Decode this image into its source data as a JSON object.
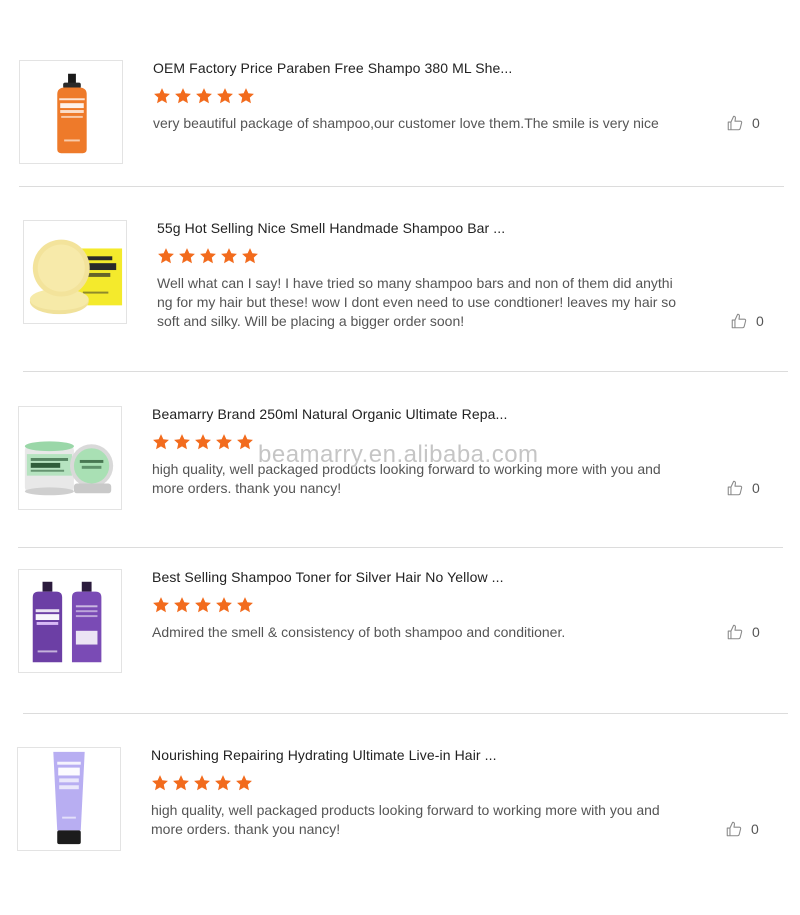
{
  "watermark": "beamarry.en.alibaba.com",
  "colors": {
    "star": "#f26b1d",
    "divider": "#dcdcdc"
  },
  "reviews": [
    {
      "title": "OEM Factory Price Paraben Free Shampo 380 ML She...",
      "rating": 5,
      "text": "very beautiful package of shampoo,our customer love them.The smile is very nice",
      "likes": "0",
      "thumbnail": "orange-jojoba-shampoo-bottle"
    },
    {
      "title": "55g Hot Selling Nice Smell Handmade Shampoo Bar ...",
      "rating": 5,
      "text": "Well what can I say! I have tried so many shampoo bars and non of them did anything for my hair but these! wow I dont even need to use condtioner! leaves my hair so soft and silky. Will be placing a bigger order soon!",
      "likes": "0",
      "thumbnail": "honey-shampoo-bar"
    },
    {
      "title": "Beamarry Brand 250ml Natural Organic Ultimate Repa...",
      "rating": 5,
      "text": "high quality, well packaged products looking forward to working more with you and more orders. thank you nancy!",
      "likes": "0",
      "thumbnail": "green-repair-hair-mask-jars"
    },
    {
      "title": "Best Selling Shampoo Toner for Silver Hair No Yellow ...",
      "rating": 5,
      "text": "Admired the smell & consistency of both shampoo and conditioner.",
      "likes": "0",
      "thumbnail": "purple-biotin-shampoo-bottles"
    },
    {
      "title": "Nourishing Repairing Hydrating Ultimate Live-in Hair ...",
      "rating": 5,
      "text": "high quality, well packaged products looking forward to working more with you and more orders. thank you nancy!",
      "likes": "0",
      "thumbnail": "lavender-repair-tube"
    }
  ]
}
